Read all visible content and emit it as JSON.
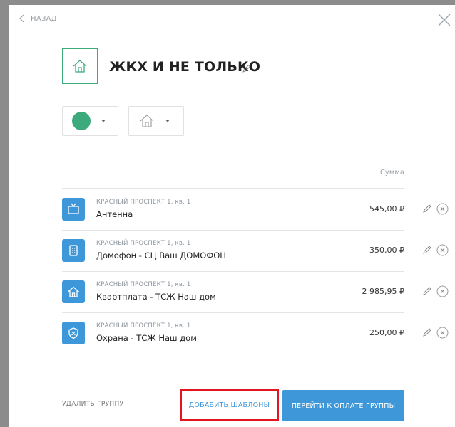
{
  "nav": {
    "back_label": "НАЗАД"
  },
  "group": {
    "title": "ЖКХ И НЕ ТОЛЬКО",
    "color": "#3caa7c",
    "icon": "house-icon"
  },
  "table": {
    "sum_header": "Сумма",
    "rows": [
      {
        "address": "КРАСНЫЙ ПРОСПЕКТ 1, кв. 1",
        "name": "Антенна",
        "amount": "545,00 ₽",
        "icon": "tv-icon"
      },
      {
        "address": "КРАСНЫЙ ПРОСПЕКТ 1, кв. 1",
        "name": "Домофон - СЦ Ваш ДОМОФОН",
        "amount": "350,00 ₽",
        "icon": "intercom-icon"
      },
      {
        "address": "КРАСНЫЙ ПРОСПЕКТ 1, кв. 1",
        "name": "Квартплата - ТСЖ Наш дом",
        "amount": "2 985,95 ₽",
        "icon": "house-icon"
      },
      {
        "address": "КРАСНЫЙ ПРОСПЕКТ 1, кв. 1",
        "name": "Охрана - ТСЖ Наш дом",
        "amount": "250,00 ₽",
        "icon": "shield-icon"
      }
    ]
  },
  "footer": {
    "delete_label": "УДАЛИТЬ ГРУППУ",
    "add_label": "ДОБАВИТЬ ШАБЛОНЫ",
    "pay_label": "ПЕРЕЙТИ К ОПЛАТЕ ГРУППЫ"
  },
  "colors": {
    "accent": "#3e97d9",
    "green": "#3caa7c",
    "highlight": "#e3151f"
  }
}
